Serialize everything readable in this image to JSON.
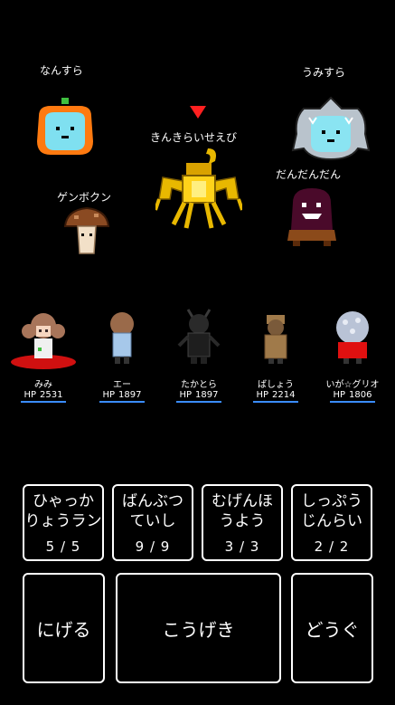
{
  "enemies": [
    {
      "name": "なんすら"
    },
    {
      "name": "うみすら"
    },
    {
      "name": "きんきらいせえび"
    },
    {
      "name": "だんだんだん"
    },
    {
      "name": "ゲンボクン"
    }
  ],
  "party": [
    {
      "name": "みみ",
      "hp_label": "HP",
      "hp": "2531"
    },
    {
      "name": "エー",
      "hp_label": "HP",
      "hp": "1897"
    },
    {
      "name": "たかとら",
      "hp_label": "HP",
      "hp": "1897"
    },
    {
      "name": "ばしょう",
      "hp_label": "HP",
      "hp": "2214"
    },
    {
      "name": "いが☆グリオ",
      "hp_label": "HP",
      "hp": "1806"
    }
  ],
  "skills": [
    {
      "line1": "ひゃっか",
      "line2": "りょうラン",
      "uses": "5 / 5"
    },
    {
      "line1": "ばんぶつ",
      "line2": "ていし",
      "uses": "9 / 9"
    },
    {
      "line1": "むげんほ",
      "line2": "うよう",
      "uses": "3 / 3"
    },
    {
      "line1": "しっぷう",
      "line2": "じんらい",
      "uses": "2 / 2"
    }
  ],
  "commands": {
    "flee": "にげる",
    "attack": "こうげき",
    "items": "どうぐ"
  },
  "colors": {
    "target_marker": "#ff2020",
    "hp_bar": "#3a8cff",
    "gold": "#e8b800"
  }
}
